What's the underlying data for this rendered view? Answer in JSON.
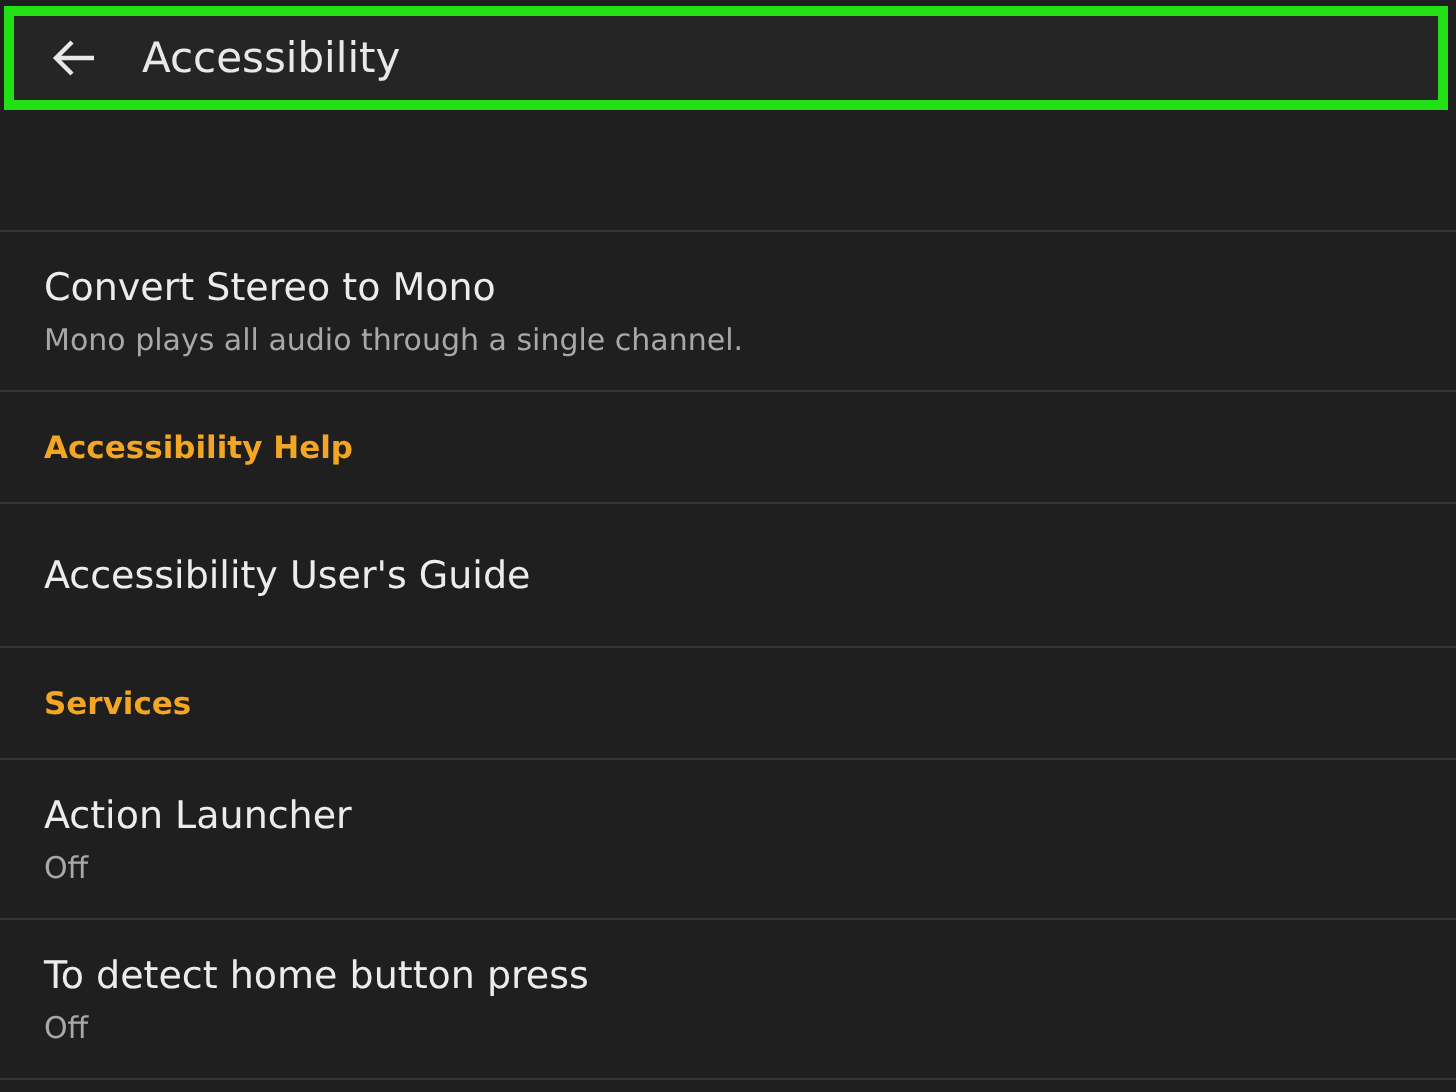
{
  "header": {
    "title": "Accessibility",
    "highlighted": true
  },
  "items": [
    {
      "kind": "setting",
      "title": "Convert Stereo to Mono",
      "subtitle": "Mono plays all audio through a single channel."
    },
    {
      "kind": "section",
      "title": "Accessibility Help"
    },
    {
      "kind": "setting",
      "title": "Accessibility User's Guide"
    },
    {
      "kind": "section",
      "title": "Services"
    },
    {
      "kind": "setting",
      "title": "Action Launcher",
      "subtitle": "Off"
    },
    {
      "kind": "setting",
      "title": "To detect home button press",
      "subtitle": "Off"
    }
  ]
}
